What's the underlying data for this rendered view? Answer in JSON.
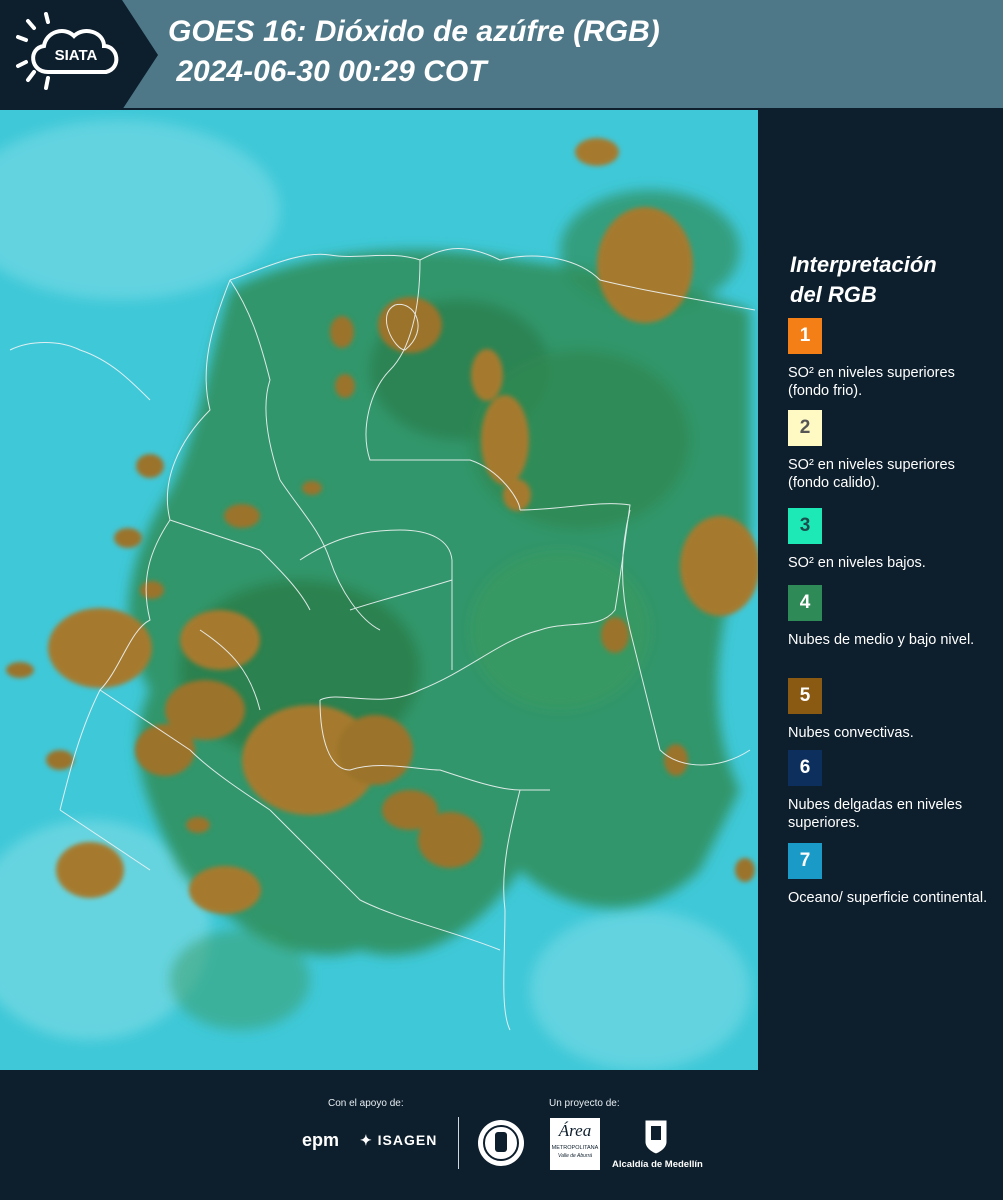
{
  "header": {
    "logo_text": "SIATA",
    "title": "GOES 16: Dióxido de azúfre (RGB)",
    "timestamp": "2024-06-30 00:29 COT"
  },
  "legend": {
    "title_line1": "Interpretación",
    "title_line2": "del RGB",
    "items": [
      {
        "number": "1",
        "color": "#f57f17",
        "text_color": "#ffffff",
        "label": "SO² en niveles superiores (fondo frio)."
      },
      {
        "number": "2",
        "color": "#fff9c4",
        "text_color": "#555555",
        "label": "SO² en niveles superiores (fondo calido)."
      },
      {
        "number": "3",
        "color": "#1de9b6",
        "text_color": "#1b4d4d",
        "label": "SO² en niveles bajos."
      },
      {
        "number": "4",
        "color": "#2e8b57",
        "text_color": "#ffffff",
        "label": "Nubes de medio y bajo nivel."
      },
      {
        "number": "5",
        "color": "#8b5a12",
        "text_color": "#ffffff",
        "label": "Nubes convectivas."
      },
      {
        "number": "6",
        "color": "#0d2f5e",
        "text_color": "#ffffff",
        "label": "Nubes delgadas en niveles superiores."
      },
      {
        "number": "7",
        "color": "#1a9bc7",
        "text_color": "#ffffff",
        "label": "Oceano/ superficie continental."
      }
    ]
  },
  "footer": {
    "support_label": "Con el apoyo de:",
    "project_label": "Un proyecto de:",
    "sponsors": [
      "epm",
      "ISAGEN"
    ],
    "partners": [
      "Área Metropolitana",
      "Alcaldía de Medellín"
    ],
    "epm_text": "epm",
    "isagen_text": "ISAGEN",
    "area_text": "Área",
    "area_sub": "METROPOLITANA",
    "area_sub2": "Valle de Aburrá",
    "alcaldia_text": "Alcaldía de Medellín"
  },
  "colors": {
    "background": "#0d1e2c",
    "header_band": "#4e7887",
    "ocean": "#3cc6d6",
    "land_green": "#2f8a55",
    "convective": "#a07a2e"
  }
}
